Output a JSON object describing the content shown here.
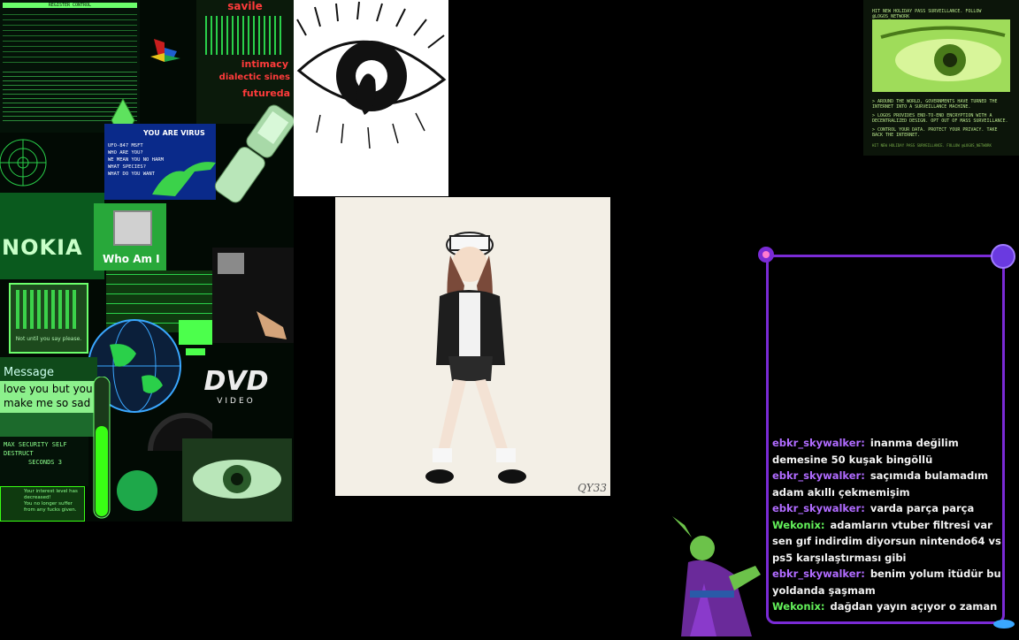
{
  "collage": {
    "terminal_header": "REGISTER CONTROL",
    "nokia": "NOKIA",
    "you_are_virus": "YOU ARE VIRUS",
    "virus_lines": [
      "UFO-847 MSFT",
      "WHO ARE YOU?",
      "WE MEAN YOU NO HARM",
      "WHAT SPECIES?",
      "WHAT DO YOU WANT"
    ],
    "who_am_i": "Who Am I",
    "message_title": "Message",
    "message_line1": "love you but you",
    "message_line2": "make me so sad",
    "dvd": "DVD",
    "dvd_sub": "VIDEO",
    "security": "MAX SECURITY SELF DESTRUCT",
    "seconds": "SECONDS  3",
    "interest": "Your interest level has decreased!",
    "longer_suffer": "You no longer suffer from any fucks given.",
    "not_ugly": "Not until you say please.",
    "poster_words": [
      "savile",
      "intimacy",
      "dialectic sines",
      "futureda"
    ]
  },
  "anime_panel": {
    "signature": "QY33"
  },
  "poster": {
    "header": "HIT NEW HOLIDAY PASS SURVEILLANCE. FOLLOW @LOGOS_NETWORK",
    "lines": [
      "> AROUND THE WORLD, GOVERNMENTS HAVE TURNED THE INTERNET INTO A SURVEILLANCE MACHINE.",
      "> LOGOS PROVIDES END-TO-END ENCRYPTION WITH A DECENTRALIZED DESIGN. OPT OUT OF MASS SURVEILLANCE.",
      "> CONTROL YOUR DATA. PROTECT YOUR PRIVACY. TAKE BACK THE INTERNET."
    ],
    "footer": "HIT NEW HOLIDAY PASS SURVEILLANCE. FOLLOW @LOGOS_NETWORK"
  },
  "chat": {
    "colors": {
      "ebkr_skywalker": "#b06bff",
      "Wekonix": "#63f05a",
      "frame": "#7a2bd6"
    },
    "messages": [
      {
        "user": "ebkr_skywalker:",
        "text": "inanma değilim demesine 50 kuşak bingöllü"
      },
      {
        "user": "ebkr_skywalker:",
        "text": "saçımıda bulamadım adam akıllı çekmemişim"
      },
      {
        "user": "ebkr_skywalker:",
        "text": "varda parça parça"
      },
      {
        "user": "Wekonix:",
        "text": "adamların vtuber filtresi var sen gıf indirdim diyorsun nintendo64 vs ps5 karşılaştırması gibi"
      },
      {
        "user": "ebkr_skywalker:",
        "text": "benim yolum itüdür bu yoldanda şaşmam"
      },
      {
        "user": "Wekonix:",
        "text": "dağdan yayın açıyor o zaman"
      }
    ]
  }
}
